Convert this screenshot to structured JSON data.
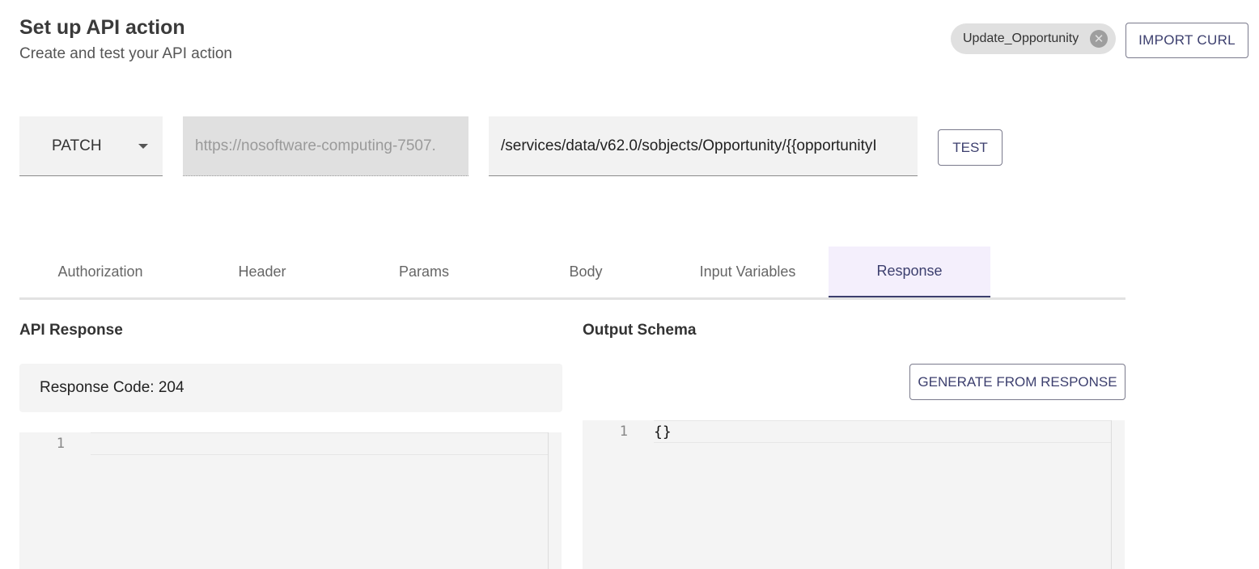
{
  "header": {
    "title": "Set up API action",
    "subtitle": "Create and test your API action",
    "action_chip": "Update_Opportunity",
    "import_curl_label": "IMPORT CURL"
  },
  "request": {
    "method": "PATCH",
    "base_url": "https://nosoftware-computing-7507.",
    "path": "/services/data/v62.0/sobjects/Opportunity/{{opportunityI",
    "test_label": "TEST"
  },
  "tabs": [
    {
      "label": "Authorization",
      "active": false
    },
    {
      "label": "Header",
      "active": false
    },
    {
      "label": "Params",
      "active": false
    },
    {
      "label": "Body",
      "active": false
    },
    {
      "label": "Input Variables",
      "active": false
    },
    {
      "label": "Response",
      "active": true
    }
  ],
  "api_response": {
    "label": "API Response",
    "response_code": "Response Code: 204",
    "line_number": "1",
    "content": ""
  },
  "output_schema": {
    "label": "Output Schema",
    "generate_label": "GENERATE FROM RESPONSE",
    "line_number": "1",
    "content": "{}"
  },
  "colors": {
    "accent": "#3c3f6e",
    "active_tab_bg": "#f4effc",
    "panel_bg": "#f4f4f4"
  }
}
